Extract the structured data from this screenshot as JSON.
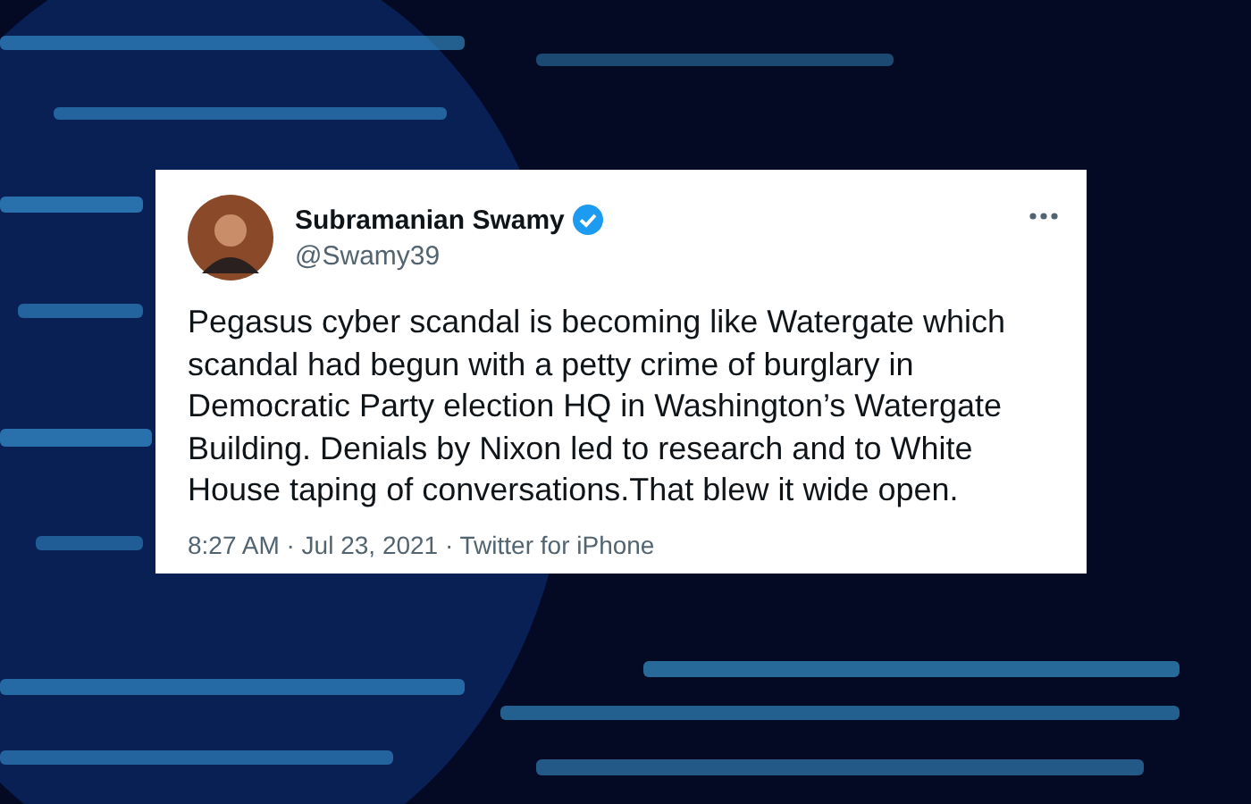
{
  "tweet": {
    "name": "Subramanian Swamy",
    "verified": true,
    "handle": "@Swamy39",
    "text": "Pegasus cyber scandal is becoming like Watergate which scandal had begun with a petty crime of burglary in Democratic Party election HQ in Washington’s Watergate Building. Denials by Nixon led to research and to White House taping of conversations.That blew it wide open.",
    "meta": "8:27 AM · Jul 23, 2021 · Twitter for iPhone"
  }
}
